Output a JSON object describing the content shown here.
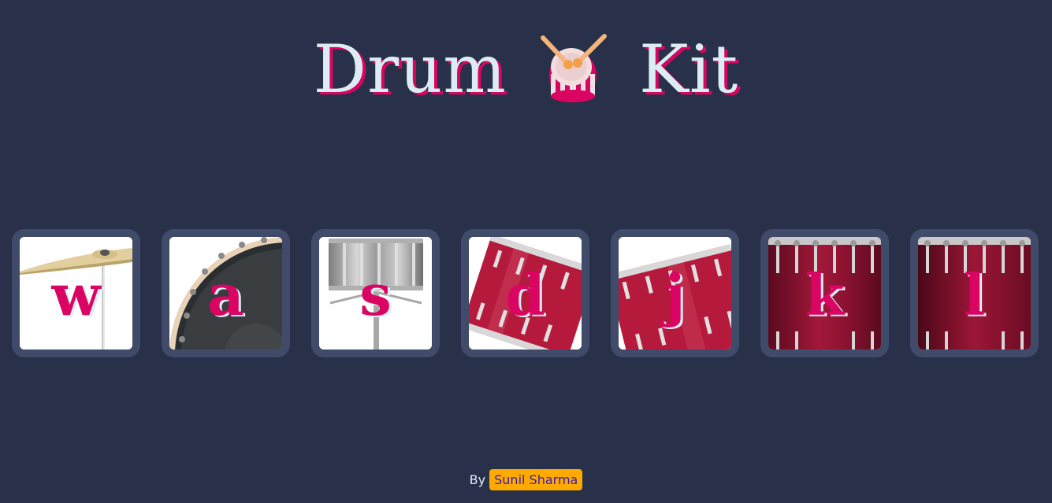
{
  "header": {
    "title_left": "Drum",
    "title_right": "Kit",
    "icon": "drum-icon"
  },
  "keys": [
    {
      "letter": "w",
      "instrument": "cymbal-icon"
    },
    {
      "letter": "a",
      "instrument": "bass-drum-icon"
    },
    {
      "letter": "s",
      "instrument": "snare-drum-icon"
    },
    {
      "letter": "d",
      "instrument": "tom-drum-icon"
    },
    {
      "letter": "j",
      "instrument": "tom-drum-icon"
    },
    {
      "letter": "k",
      "instrument": "floor-tom-icon"
    },
    {
      "letter": "l",
      "instrument": "floor-tom-icon"
    }
  ],
  "footer": {
    "by_label": "By",
    "author": "Sunil Sharma"
  },
  "colors": {
    "background": "#283149",
    "key_frame": "#404b69",
    "accent": "#da0463",
    "light": "#dbedf3",
    "badge": "#ffaa00"
  }
}
